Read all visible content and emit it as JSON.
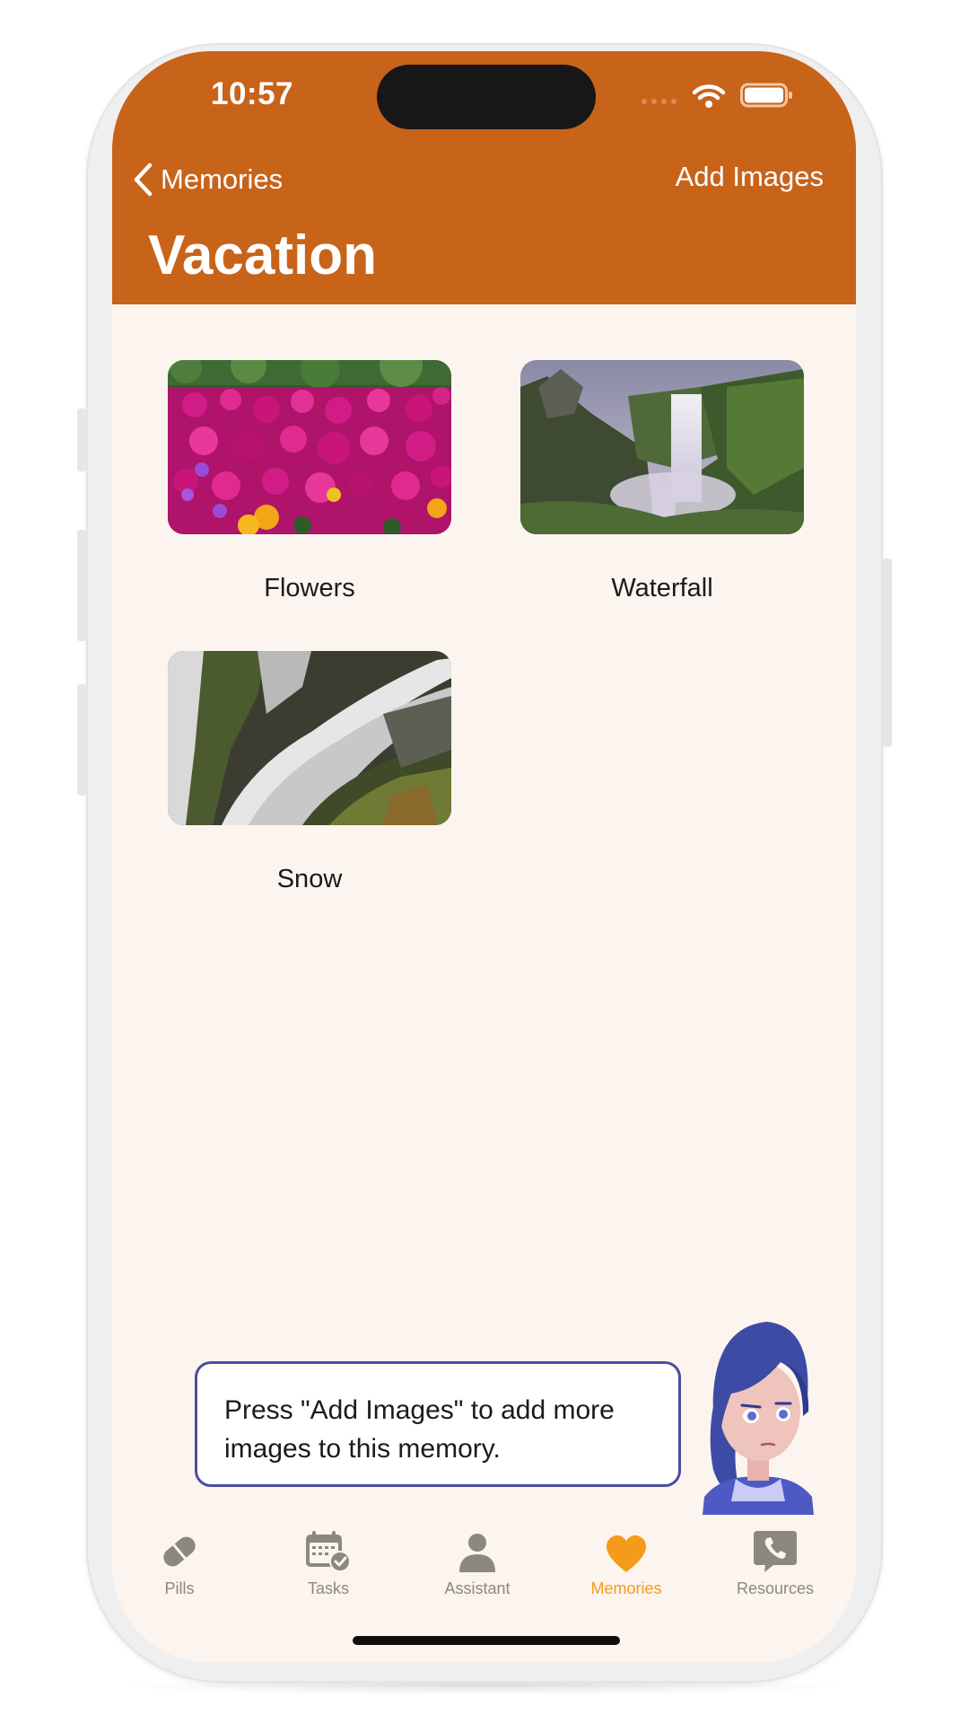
{
  "status_bar": {
    "time": "10:57"
  },
  "nav": {
    "back_label": "Memories",
    "action_label": "Add Images",
    "title": "Vacation"
  },
  "memories": [
    {
      "caption": "Flowers",
      "image": "flowers-photo"
    },
    {
      "caption": "Waterfall",
      "image": "waterfall-photo"
    },
    {
      "caption": "Snow",
      "image": "cascade-photo"
    }
  ],
  "assistant": {
    "message": "Press \"Add Images\" to add more images to this memory."
  },
  "tab_bar": {
    "tabs": [
      {
        "label": "Pills",
        "icon": "pill-icon",
        "active": false
      },
      {
        "label": "Tasks",
        "icon": "calendar-check-icon",
        "active": false
      },
      {
        "label": "Assistant",
        "icon": "person-icon",
        "active": false
      },
      {
        "label": "Memories",
        "icon": "heart-icon",
        "active": true
      },
      {
        "label": "Resources",
        "icon": "phone-bubble-icon",
        "active": false
      }
    ]
  },
  "colors": {
    "header": "#c8631a",
    "background": "#fcf4ee",
    "active_tab": "#f59b1c",
    "inactive_tab": "#8c8881",
    "bubble_border": "#4b4ca0"
  }
}
